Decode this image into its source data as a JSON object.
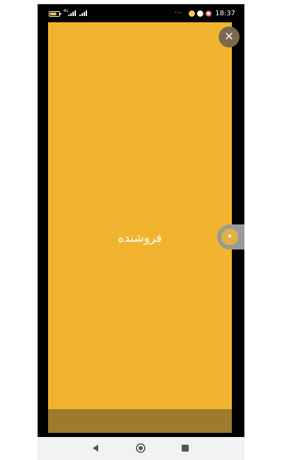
{
  "status_bar": {
    "network_label": "4G",
    "clock": "18:37",
    "more": "···"
  },
  "panel": {
    "title": "فروشنده",
    "background": "#f2b42e"
  },
  "close_button": {
    "symbol": "✕"
  },
  "side_tab": {
    "symbol": "▾"
  },
  "icons": {
    "battery": "battery-icon",
    "signal": "signal-icon",
    "back": "back-triangle-icon",
    "home": "home-circle-icon",
    "recent": "recent-square-icon"
  }
}
